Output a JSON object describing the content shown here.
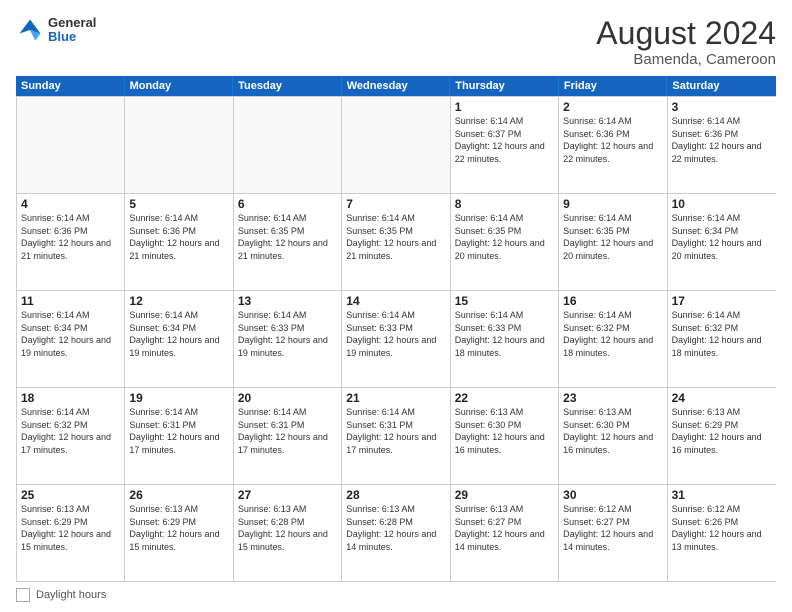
{
  "header": {
    "logo_general": "General",
    "logo_blue": "Blue",
    "month_year": "August 2024",
    "location": "Bamenda, Cameroon"
  },
  "days_of_week": [
    "Sunday",
    "Monday",
    "Tuesday",
    "Wednesday",
    "Thursday",
    "Friday",
    "Saturday"
  ],
  "legend_label": "Daylight hours",
  "weeks": [
    [
      {
        "day": "",
        "empty": true
      },
      {
        "day": "",
        "empty": true
      },
      {
        "day": "",
        "empty": true
      },
      {
        "day": "",
        "empty": true
      },
      {
        "day": "1",
        "sunrise": "6:14 AM",
        "sunset": "6:37 PM",
        "daylight": "12 hours and 22 minutes."
      },
      {
        "day": "2",
        "sunrise": "6:14 AM",
        "sunset": "6:36 PM",
        "daylight": "12 hours and 22 minutes."
      },
      {
        "day": "3",
        "sunrise": "6:14 AM",
        "sunset": "6:36 PM",
        "daylight": "12 hours and 22 minutes."
      }
    ],
    [
      {
        "day": "4",
        "sunrise": "6:14 AM",
        "sunset": "6:36 PM",
        "daylight": "12 hours and 21 minutes."
      },
      {
        "day": "5",
        "sunrise": "6:14 AM",
        "sunset": "6:36 PM",
        "daylight": "12 hours and 21 minutes."
      },
      {
        "day": "6",
        "sunrise": "6:14 AM",
        "sunset": "6:35 PM",
        "daylight": "12 hours and 21 minutes."
      },
      {
        "day": "7",
        "sunrise": "6:14 AM",
        "sunset": "6:35 PM",
        "daylight": "12 hours and 21 minutes."
      },
      {
        "day": "8",
        "sunrise": "6:14 AM",
        "sunset": "6:35 PM",
        "daylight": "12 hours and 20 minutes."
      },
      {
        "day": "9",
        "sunrise": "6:14 AM",
        "sunset": "6:35 PM",
        "daylight": "12 hours and 20 minutes."
      },
      {
        "day": "10",
        "sunrise": "6:14 AM",
        "sunset": "6:34 PM",
        "daylight": "12 hours and 20 minutes."
      }
    ],
    [
      {
        "day": "11",
        "sunrise": "6:14 AM",
        "sunset": "6:34 PM",
        "daylight": "12 hours and 19 minutes."
      },
      {
        "day": "12",
        "sunrise": "6:14 AM",
        "sunset": "6:34 PM",
        "daylight": "12 hours and 19 minutes."
      },
      {
        "day": "13",
        "sunrise": "6:14 AM",
        "sunset": "6:33 PM",
        "daylight": "12 hours and 19 minutes."
      },
      {
        "day": "14",
        "sunrise": "6:14 AM",
        "sunset": "6:33 PM",
        "daylight": "12 hours and 19 minutes."
      },
      {
        "day": "15",
        "sunrise": "6:14 AM",
        "sunset": "6:33 PM",
        "daylight": "12 hours and 18 minutes."
      },
      {
        "day": "16",
        "sunrise": "6:14 AM",
        "sunset": "6:32 PM",
        "daylight": "12 hours and 18 minutes."
      },
      {
        "day": "17",
        "sunrise": "6:14 AM",
        "sunset": "6:32 PM",
        "daylight": "12 hours and 18 minutes."
      }
    ],
    [
      {
        "day": "18",
        "sunrise": "6:14 AM",
        "sunset": "6:32 PM",
        "daylight": "12 hours and 17 minutes."
      },
      {
        "day": "19",
        "sunrise": "6:14 AM",
        "sunset": "6:31 PM",
        "daylight": "12 hours and 17 minutes."
      },
      {
        "day": "20",
        "sunrise": "6:14 AM",
        "sunset": "6:31 PM",
        "daylight": "12 hours and 17 minutes."
      },
      {
        "day": "21",
        "sunrise": "6:14 AM",
        "sunset": "6:31 PM",
        "daylight": "12 hours and 17 minutes."
      },
      {
        "day": "22",
        "sunrise": "6:13 AM",
        "sunset": "6:30 PM",
        "daylight": "12 hours and 16 minutes."
      },
      {
        "day": "23",
        "sunrise": "6:13 AM",
        "sunset": "6:30 PM",
        "daylight": "12 hours and 16 minutes."
      },
      {
        "day": "24",
        "sunrise": "6:13 AM",
        "sunset": "6:29 PM",
        "daylight": "12 hours and 16 minutes."
      }
    ],
    [
      {
        "day": "25",
        "sunrise": "6:13 AM",
        "sunset": "6:29 PM",
        "daylight": "12 hours and 15 minutes."
      },
      {
        "day": "26",
        "sunrise": "6:13 AM",
        "sunset": "6:29 PM",
        "daylight": "12 hours and 15 minutes."
      },
      {
        "day": "27",
        "sunrise": "6:13 AM",
        "sunset": "6:28 PM",
        "daylight": "12 hours and 15 minutes."
      },
      {
        "day": "28",
        "sunrise": "6:13 AM",
        "sunset": "6:28 PM",
        "daylight": "12 hours and 14 minutes."
      },
      {
        "day": "29",
        "sunrise": "6:13 AM",
        "sunset": "6:27 PM",
        "daylight": "12 hours and 14 minutes."
      },
      {
        "day": "30",
        "sunrise": "6:12 AM",
        "sunset": "6:27 PM",
        "daylight": "12 hours and 14 minutes."
      },
      {
        "day": "31",
        "sunrise": "6:12 AM",
        "sunset": "6:26 PM",
        "daylight": "12 hours and 13 minutes."
      }
    ]
  ]
}
